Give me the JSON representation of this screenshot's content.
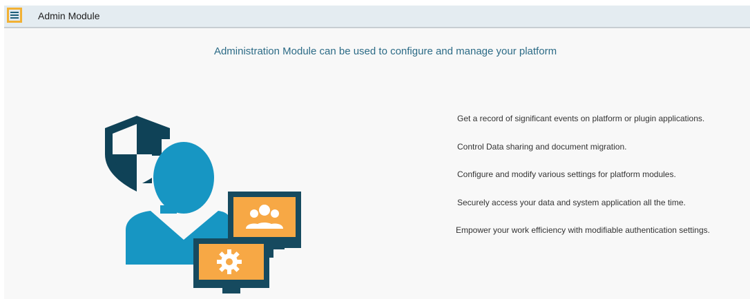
{
  "header": {
    "title": "Admin Module",
    "menu_icon": "hamburger-menu-icon"
  },
  "main": {
    "headline": "Administration Module can be used to configure and manage your platform",
    "illustration_icons": [
      "shield-icon",
      "admin-user-icon",
      "monitor-users-icon",
      "monitor-gear-icon"
    ],
    "features": [
      "Get a record of significant events on platform or plugin applications.",
      "Control Data sharing and document migration.",
      "Configure and modify various settings for platform modules.",
      "Securely access your data and system application all the time.",
      "Empower your work efficiency with modifiable authentication settings."
    ]
  },
  "colors": {
    "topbar_bg": "#e4ecf1",
    "menu_border": "#f2b134",
    "headline": "#2c6b86",
    "shield": "#0f4257",
    "user": "#1796c3",
    "monitor_frame": "#164a5f",
    "monitor_screen": "#f7a845"
  }
}
